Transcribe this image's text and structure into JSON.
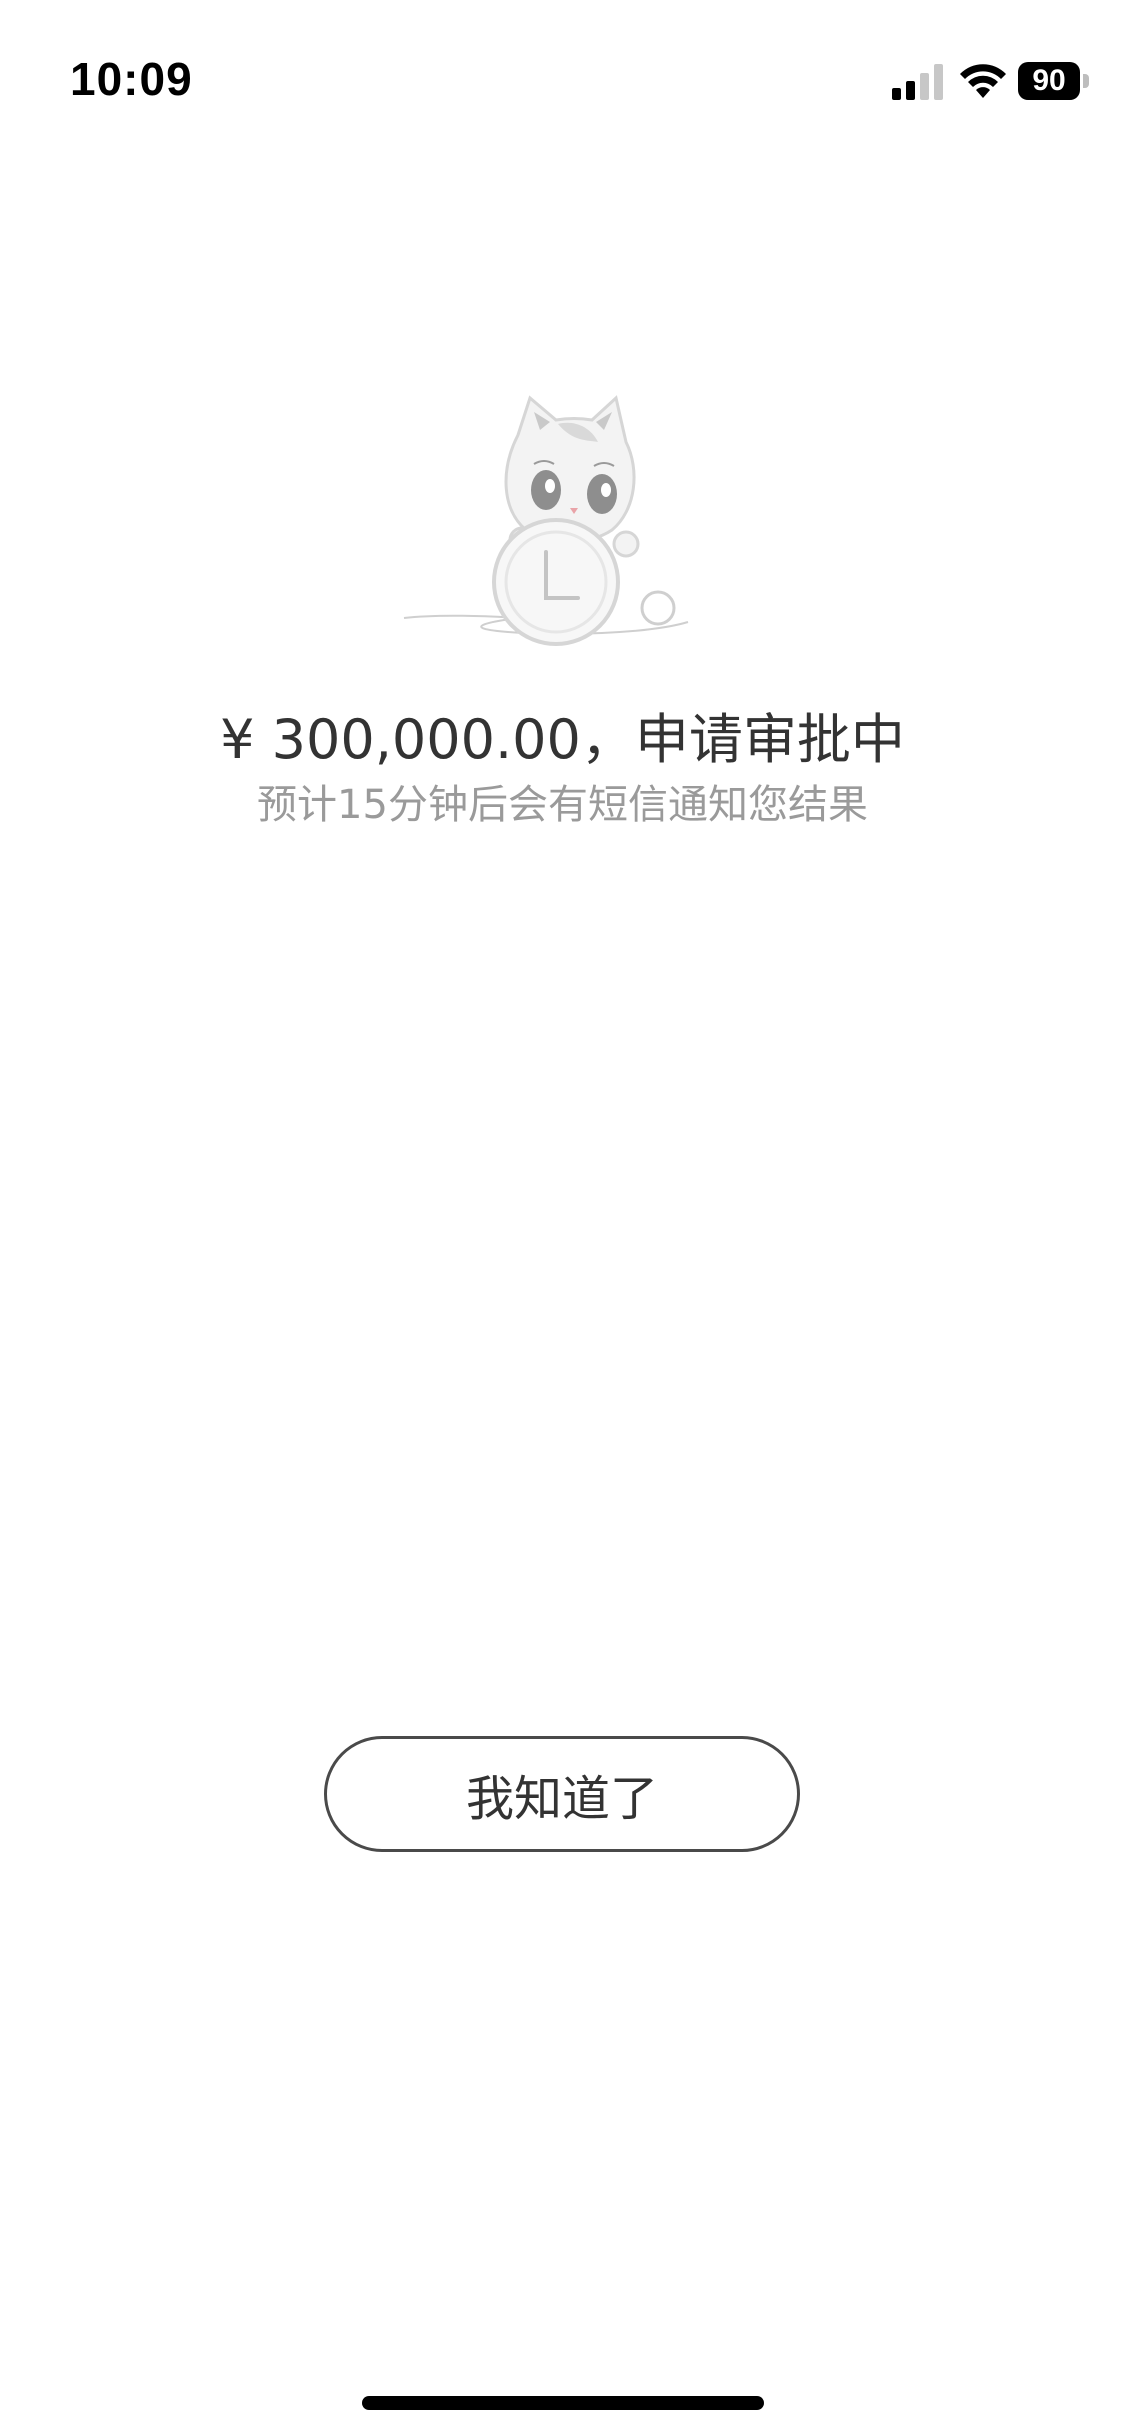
{
  "status_bar": {
    "time": "10:09",
    "battery_level": "90",
    "signal_bars_active": 2,
    "signal_bars_total": 4
  },
  "illustration": {
    "icon": "cat-holding-clock-illustration"
  },
  "result": {
    "title": "¥ 300,000.00，申请审批中",
    "subtitle": "预计15分钟后会有短信通知您结果"
  },
  "actions": {
    "confirm_label": "我知道了"
  },
  "colors": {
    "title": "#333333",
    "subtitle": "#9a9a9a",
    "button_border": "#4a4a4a",
    "background": "#ffffff"
  }
}
